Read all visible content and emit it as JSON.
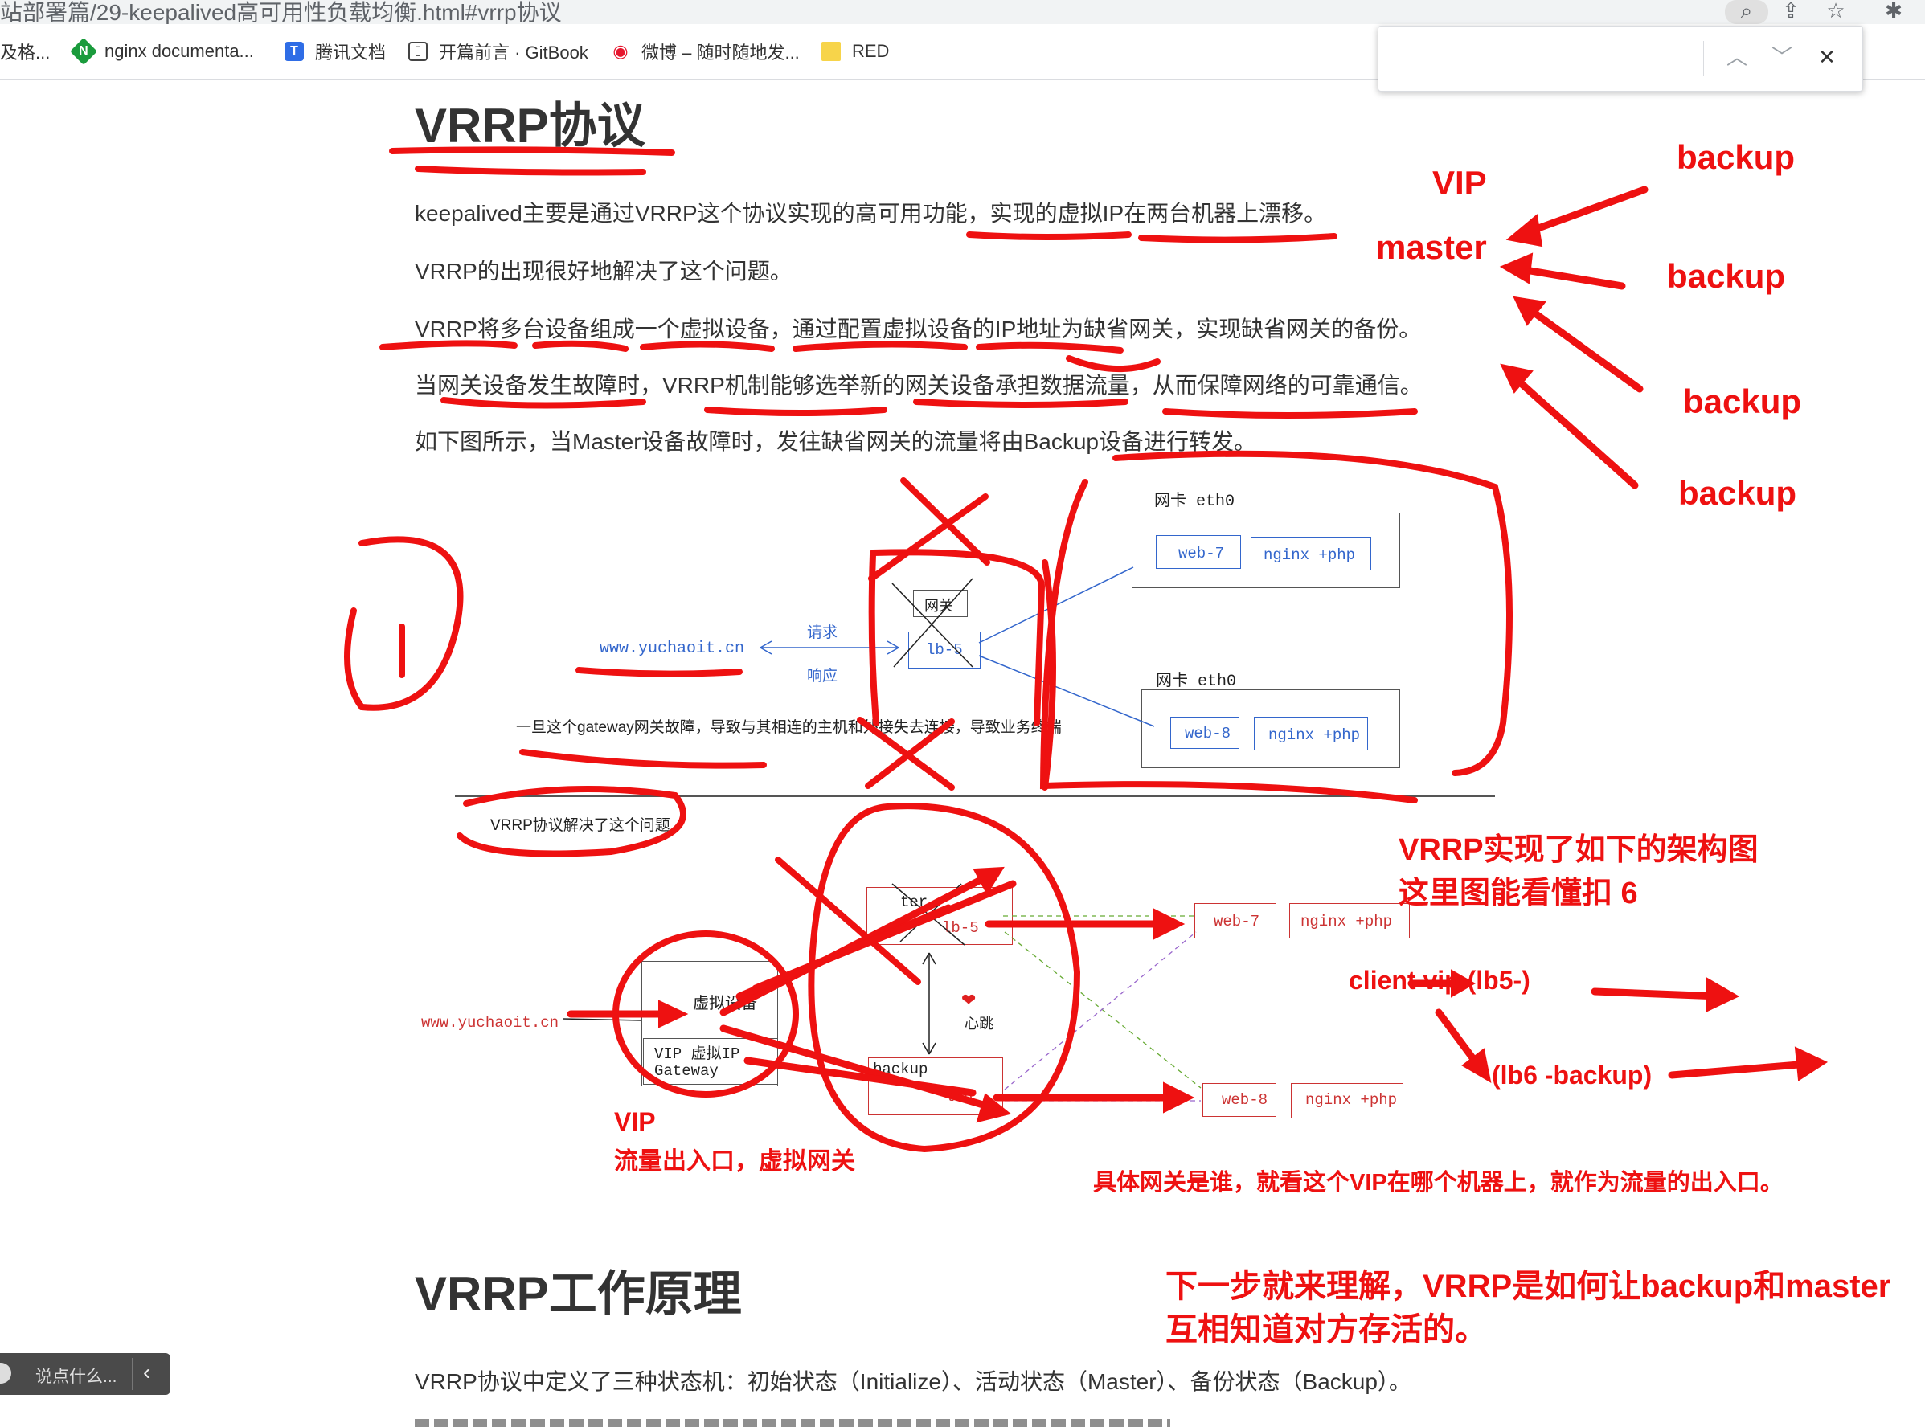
{
  "browser": {
    "url": "站部署篇/29-keepalived高可用性负载均衡.html#vrrp协议",
    "bookmarks": [
      {
        "label": "及格...",
        "icon": "folder-icon"
      },
      {
        "label": "nginx documenta...",
        "icon": "nginx-icon"
      },
      {
        "label": "腾讯文档",
        "icon": "tencent-docs-icon"
      },
      {
        "label": "开篇前言 · GitBook",
        "icon": "book-icon"
      },
      {
        "label": "微博 – 随时随地发...",
        "icon": "weibo-icon"
      },
      {
        "label": "RED",
        "icon": "folder-icon"
      }
    ],
    "find_value": ""
  },
  "article": {
    "title": "VRRP协议",
    "paragraphs": [
      "keepalived主要是通过VRRP这个协议实现的高可用功能，实现的虚拟IP在两台机器上漂移。",
      "VRRP的出现很好地解决了这个问题。",
      "VRRP将多台设备组成一个虚拟设备，通过配置虚拟设备的IP地址为缺省网关，实现缺省网关的备份。",
      "当网关设备发生故障时，VRRP机制能够选举新的网关设备承担数据流量，从而保障网络的可靠通信。",
      "如下图所示，当Master设备故障时，发往缺省网关的流量将由Backup设备进行转发。"
    ],
    "section2_title": "VRRP工作原理",
    "section2_paragraph": "VRRP协议中定义了三种状态机：初始状态（Initialize）、活动状态（Master）、备份状态（Backup）。"
  },
  "diagram": {
    "nic_top": "网卡 eth0",
    "nic_bottom": "网卡 eth0",
    "web7": "web-7",
    "web8": "web-8",
    "nginx_php": "nginx +php",
    "gateway": "网关",
    "lb5": "lb-5",
    "site": "www.yuchaoit.cn",
    "request": "请求",
    "response": "响应",
    "failure_caption": "一旦这个gateway网关故障，导致与其相连的主机和外接失去连接，导致业务终端",
    "vrrp_solves": "VRRP协议解决了这个问题",
    "virtual_device": "虚拟设备",
    "vip_gateway_l1": "VIP 虚拟IP",
    "vip_gateway_l2": "Gateway",
    "master": "ter",
    "backup": "backup",
    "lb6": "lb6",
    "heartbeat": "心跳"
  },
  "annotations": {
    "vip_top": "VIP",
    "master": "master",
    "backup_1": "backup",
    "backup_2": "backup",
    "backup_3": "backup",
    "backup_4": "backup",
    "arch_l1": "VRRP实现了如下的架构图",
    "arch_l2": "这里图能看懂扣 6",
    "client_vip": "client   vip (lb5-)",
    "lb6_backup": "(lb6 -backup)",
    "vip_bottom": "VIP",
    "vip_bottom_desc": "流量出入口，虚拟网关",
    "gateway_explain": "具体网关是谁，就看这个VIP在哪个机器上，就作为流量的出入口。",
    "next_l1": "下一步就来理解，VRRP是如何让backup和master",
    "next_l2": "互相知道对方存活的。"
  },
  "comment": {
    "placeholder": "说点什么..."
  },
  "colors": {
    "annotation": "#ee1111",
    "diagram_blue": "#3366cc",
    "diagram_red": "#d22"
  }
}
